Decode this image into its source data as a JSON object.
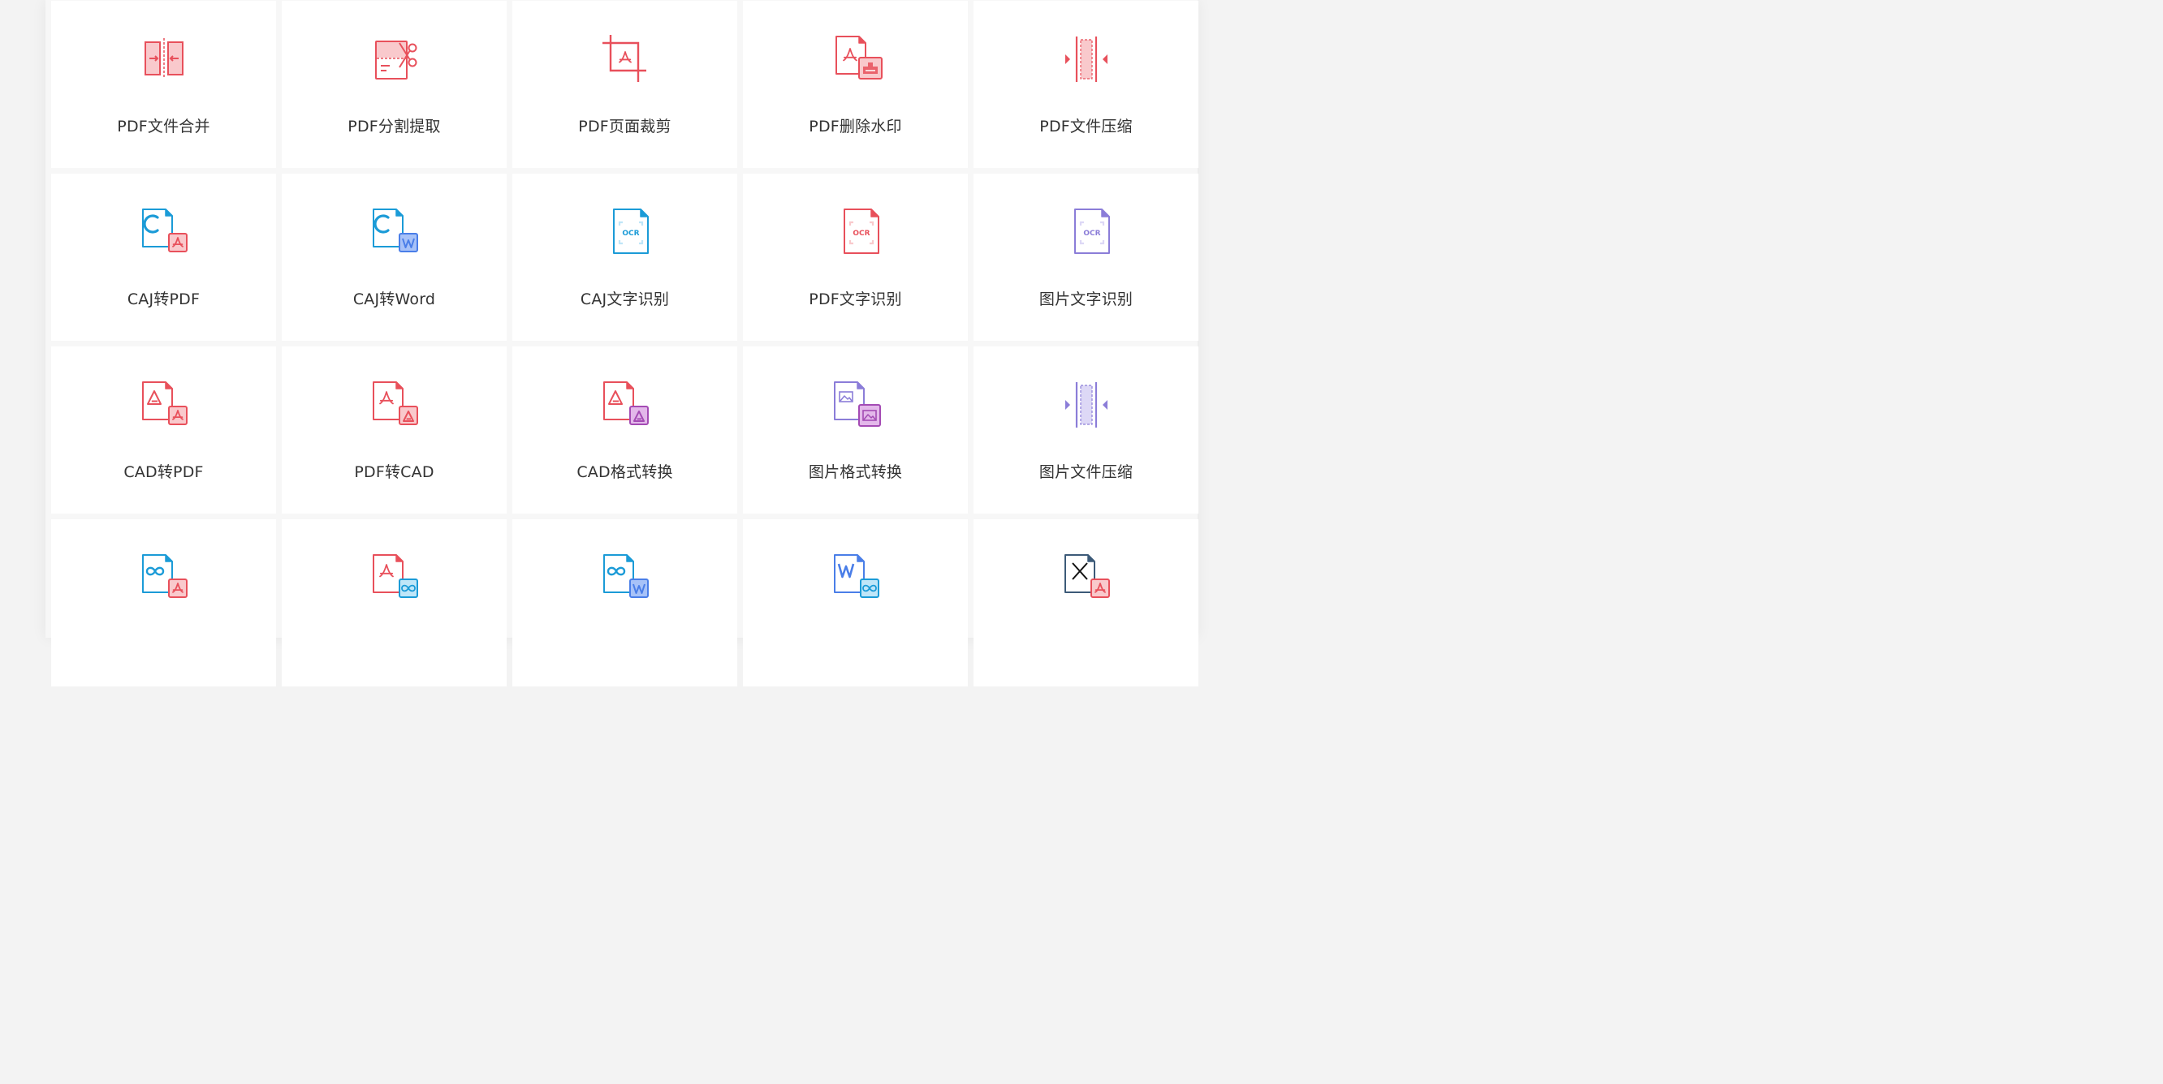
{
  "colors": {
    "red": "#e8505b",
    "red_fill": "#f9c9cc",
    "blue": "#1b9bd7",
    "blue_fill": "#bfe6f8",
    "word_blue": "#4a7ee8",
    "word_fill": "#a7c2f8",
    "purple": "#8b7dd8",
    "purple_fill": "#ddd8f6",
    "magenta": "#a44bb4",
    "magenta_fill": "#e3b8ea",
    "navy": "#3c5a78"
  },
  "tools": [
    {
      "label": "",
      "icon": "hidden-icon"
    },
    {
      "label": "",
      "icon": "hidden-icon"
    },
    {
      "label": "",
      "icon": "hidden-icon"
    },
    {
      "label": "",
      "icon": "hidden-icon"
    },
    {
      "label": "",
      "icon": "hidden-icon"
    },
    {
      "label": "PDF文件合并",
      "icon": "pdf-merge-icon"
    },
    {
      "label": "PDF分割提取",
      "icon": "pdf-split-icon"
    },
    {
      "label": "PDF页面裁剪",
      "icon": "pdf-crop-icon"
    },
    {
      "label": "PDF删除水印",
      "icon": "pdf-remove-watermark-icon"
    },
    {
      "label": "PDF文件压缩",
      "icon": "pdf-compress-icon"
    },
    {
      "label": "CAJ转PDF",
      "icon": "caj-to-pdf-icon"
    },
    {
      "label": "CAJ转Word",
      "icon": "caj-to-word-icon"
    },
    {
      "label": "CAJ文字识别",
      "icon": "caj-ocr-icon"
    },
    {
      "label": "PDF文字识别",
      "icon": "pdf-ocr-icon"
    },
    {
      "label": "图片文字识别",
      "icon": "image-ocr-icon"
    },
    {
      "label": "CAD转PDF",
      "icon": "cad-to-pdf-icon"
    },
    {
      "label": "PDF转CAD",
      "icon": "pdf-to-cad-icon"
    },
    {
      "label": "CAD格式转换",
      "icon": "cad-format-convert-icon"
    },
    {
      "label": "图片格式转换",
      "icon": "image-format-convert-icon"
    },
    {
      "label": "图片文件压缩",
      "icon": "image-compress-icon"
    },
    {
      "label": "",
      "icon": "ofd-to-pdf-icon"
    },
    {
      "label": "",
      "icon": "pdf-to-ofd-icon"
    },
    {
      "label": "",
      "icon": "ofd-to-word-icon"
    },
    {
      "label": "",
      "icon": "word-to-ofd-icon"
    },
    {
      "label": "",
      "icon": "xps-to-pdf-icon"
    }
  ]
}
